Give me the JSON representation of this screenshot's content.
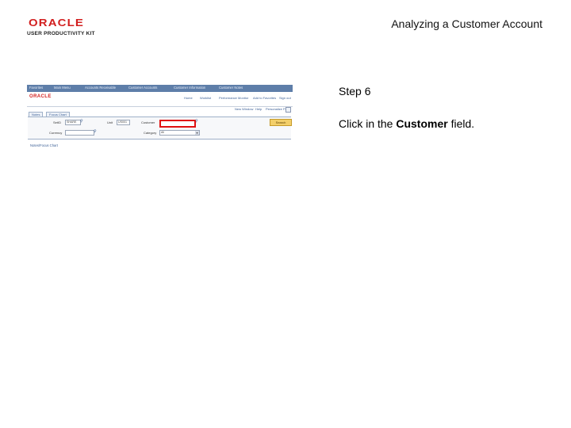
{
  "header": {
    "brand": "ORACLE",
    "brand_sub": "USER PRODUCTIVITY KIT",
    "doc_title": "Analyzing a Customer Account"
  },
  "step": {
    "label": "Step 6",
    "instruction_before": "Click in the ",
    "instruction_bold": "Customer",
    "instruction_after": " field."
  },
  "screenshot": {
    "nav_items": [
      "Favorites",
      "Main Menu",
      "Accounts Receivable",
      "Customer Accounts",
      "Customer Information",
      "Customer Notes"
    ],
    "brand": "ORACLE",
    "header_links": [
      "Home",
      "Worklist",
      "Performance Monitor",
      "Add to Favorites",
      "Sign out"
    ],
    "toolbar_links": [
      "New Window",
      "Help",
      "Personalize Page"
    ],
    "tabs": [
      "Notes",
      "Focus Chart"
    ],
    "fields": {
      "setid_label": "SetID",
      "setid_value": "SHARE",
      "unit_label": "Unit",
      "unit_value": "US001",
      "customer_label": "Customer",
      "currency_label": "Currency",
      "currency_value": "",
      "category_label": "Category",
      "category_value": "All"
    },
    "search_button": "Search",
    "footer_link": "Notes/Focus Chart"
  },
  "colors": {
    "highlight": "#e01010",
    "brand_red": "#d21f1f",
    "nav_blue": "#5e7ea9"
  }
}
